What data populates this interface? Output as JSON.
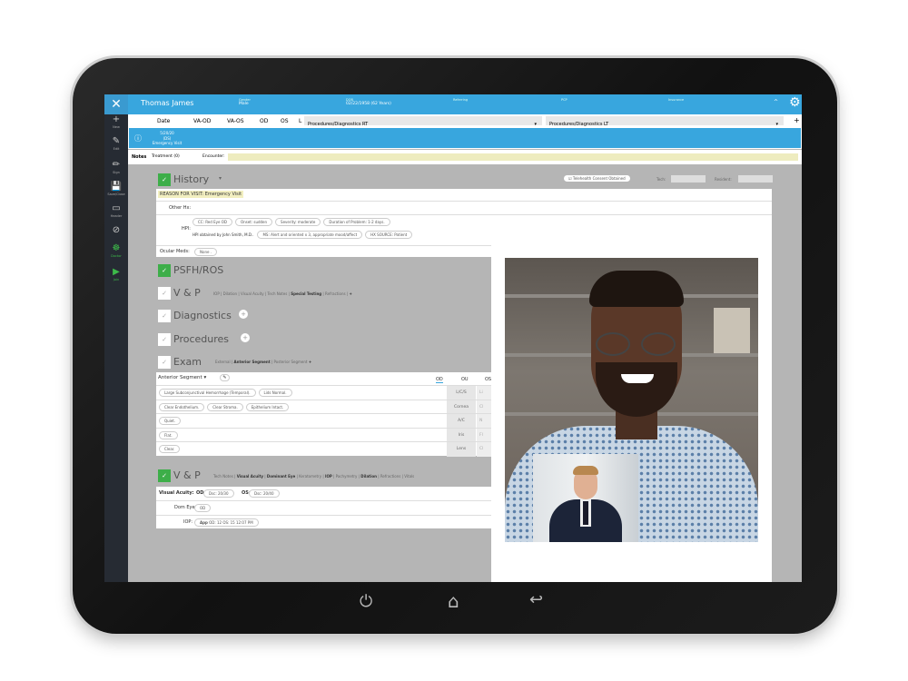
{
  "patient": {
    "name": "Thomas James",
    "gender_label": "Gender",
    "gender": "Male",
    "dob_label": "DOB",
    "dob": "02/22/1958 (62 Years)",
    "referring_label": "Referring",
    "pcp_label": "PCP",
    "insurance_label": "Insurance"
  },
  "sidebar": {
    "items": [
      {
        "label": "New",
        "icon": "+"
      },
      {
        "label": "Edit",
        "icon": "✎"
      },
      {
        "label": "Sign",
        "icon": "✏"
      },
      {
        "label": "Save/Close",
        "icon": "💾"
      },
      {
        "label": "Header",
        "icon": "▭"
      },
      {
        "label": "",
        "icon": "⊘"
      },
      {
        "label": "Doctor",
        "icon": "☸"
      },
      {
        "label": "Join",
        "icon": "▶"
      }
    ]
  },
  "grid": {
    "columns": [
      "Date",
      "VA-OD",
      "VA-OS",
      "OD",
      "OS",
      "L"
    ],
    "proc_rt": "Procedures/Diagnostics RT",
    "proc_lt": "Procedures/Diagnostics LT"
  },
  "encounter": {
    "date": "5/20/20",
    "code": "(DS)",
    "type": "Emergency Visit"
  },
  "notes": {
    "label": "Notes",
    "treatment": "Treatment (0)",
    "encounter_label": "Encounter:"
  },
  "history": {
    "title": "History",
    "telehealth": "Telehealth Consent Obtained",
    "tech_label": "Tech:",
    "resident_label": "Resident:",
    "reason": "REASON FOR VISIT: Emergency Visit",
    "other_hx": "Other Hx:",
    "hpi_label": "HPI:",
    "hpi_pills": [
      "CC: Red Eye OD",
      "Onset: sudden",
      "Severity: moderate",
      "Duration of Problem: 1-2 days."
    ],
    "hpi_by": "HPI obtained by John Smith, M.D..",
    "hpi_pills2": [
      "MS: Alert and oriented x 3, appropriate mood/affect",
      "HX SOURCE: Patient"
    ],
    "ocular_meds_label": "Ocular Meds:",
    "ocular_meds": "None ."
  },
  "sections": {
    "psfh": "PSFH/ROS",
    "vp": "V & P",
    "vp_links": [
      "IOP",
      "Dilation",
      "Visual Acuity",
      "Tech Notes",
      "Special Testing",
      "Refractions"
    ],
    "diagnostics": "Diagnostics",
    "procedures": "Procedures",
    "exam": "Exam",
    "exam_links": [
      "External",
      "Anterior Segment",
      "Posterior Segment"
    ]
  },
  "anterior": {
    "title": "Anterior Segment",
    "tabs": [
      "OD",
      "OU",
      "OS"
    ],
    "rows": [
      {
        "label": "L/C/S",
        "pills": [
          "Large Subconjunctival Hemorrhage (Temporal).",
          "Lids Normal."
        ],
        "os": "Li"
      },
      {
        "label": "Cornea",
        "pills": [
          "Clear Endothelium.",
          "Clear Stroma.",
          "Epithelium Intact."
        ],
        "os": "Cl"
      },
      {
        "label": "A/C",
        "pills": [
          "Quiet."
        ],
        "os": "N"
      },
      {
        "label": "Iris",
        "pills": [
          "Flat."
        ],
        "os": "Fl"
      },
      {
        "label": "Lens",
        "pills": [
          "Clear."
        ],
        "os": "Cl"
      }
    ]
  },
  "vp2": {
    "title": "V & P",
    "links": [
      "Tech Notes",
      "Visual Acuity",
      "Dominant Eye",
      "Keratometry",
      "IOP",
      "Pachymetry",
      "Dilation",
      "Refractions",
      "Vitals"
    ],
    "va_label": "Visual Acuity:",
    "od_label": "OD:",
    "od": "Dsc: 20/30",
    "os_label": "OS:",
    "os": "Dsc: 20/40",
    "dom_label": "Dom Eye:",
    "dom": "OD",
    "iop_label": "IOP:",
    "iop_method": "App",
    "iop": "OD: 12  OS: 15  12:07 PM"
  },
  "colors": {
    "header": "#38a6de",
    "sidebar": "#262b33",
    "check": "#3dae49",
    "reason_bg": "#f2efc0"
  }
}
